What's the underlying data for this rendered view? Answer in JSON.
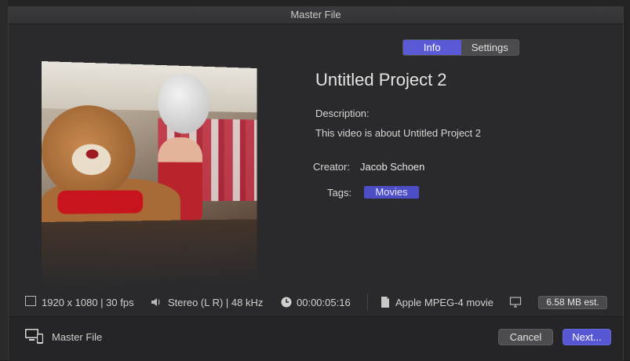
{
  "window": {
    "title": "Master File"
  },
  "tabs": [
    {
      "label": "Info",
      "active": true
    },
    {
      "label": "Settings",
      "active": false
    }
  ],
  "project": {
    "title": "Untitled Project 2",
    "description_label": "Description:",
    "description": "This video is about Untitled Project 2",
    "creator_label": "Creator:",
    "creator": "Jacob Schoen",
    "tags_label": "Tags:",
    "tags": [
      "Movies"
    ]
  },
  "status": {
    "resolution": "1920 x 1080 | 30 fps",
    "audio": "Stereo (L R) | 48 kHz",
    "duration": "00:00:05:16",
    "format": "Apple MPEG-4 movie",
    "size": "6.58 MB est."
  },
  "footer": {
    "destination": "Master File",
    "cancel_label": "Cancel",
    "next_label": "Next..."
  },
  "colors": {
    "accent": "#5757d4",
    "tag": "#4d4dc6",
    "background": "#2a2a2c"
  },
  "icons": {
    "frame": "frame-size-icon",
    "speaker": "speaker-icon",
    "clock": "clock-icon",
    "file": "document-icon",
    "display": "display-icon",
    "device": "devices-icon"
  }
}
